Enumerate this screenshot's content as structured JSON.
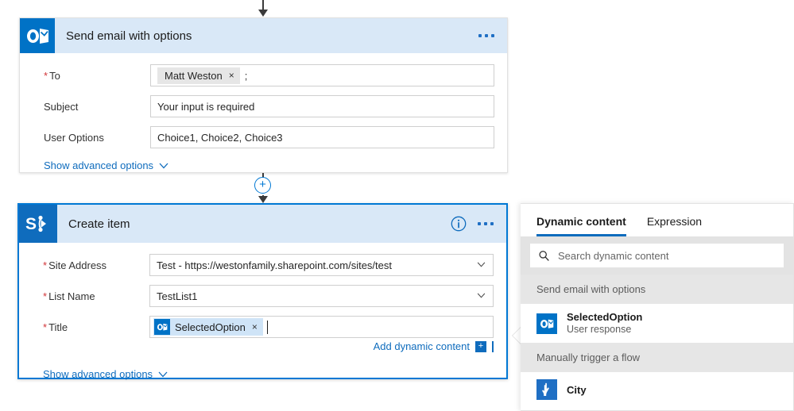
{
  "colors": {
    "accent": "#0078d4",
    "link": "#0f6cbd",
    "card_header_bg": "#d9e8f7",
    "required_star": "#d13438",
    "outlook_blue": "#0072c6",
    "sharepoint_blue": "#0f6cbd",
    "token_blue": "#cfe4f7",
    "token_gray": "#e6e6e6"
  },
  "flow": {
    "top_connector": {
      "name": "arrow-down"
    },
    "mid_connector": {
      "plus_label": "+"
    },
    "cards": [
      {
        "id": "send-email-with-options",
        "icon": "outlook-icon",
        "title": "Send email with options",
        "selected": false,
        "has_info": false,
        "ellipsis_label": "•••",
        "fields": [
          {
            "label": "To",
            "required": true,
            "type": "token",
            "token": {
              "text": "Matt Weston",
              "close": "×"
            },
            "trailing": ";"
          },
          {
            "label": "Subject",
            "required": false,
            "type": "text",
            "value": "Your input is required"
          },
          {
            "label": "User Options",
            "required": false,
            "type": "text",
            "value": "Choice1, Choice2, Choice3"
          }
        ],
        "show_advanced": "Show advanced options"
      },
      {
        "id": "create-item",
        "icon": "sharepoint-icon",
        "title": "Create item",
        "selected": true,
        "has_info": true,
        "ellipsis_label": "•••",
        "fields": [
          {
            "label": "Site Address",
            "required": true,
            "type": "dropdown",
            "value": "Test - https://westonfamily.sharepoint.com/sites/test"
          },
          {
            "label": "List Name",
            "required": true,
            "type": "dropdown",
            "value": "TestList1"
          },
          {
            "label": "Title",
            "required": true,
            "type": "dynamic-token",
            "token": {
              "icon": "outlook-icon",
              "text": "SelectedOption",
              "close": "×"
            }
          }
        ],
        "add_dynamic_content": "Add dynamic content",
        "add_dynamic_plus": "+",
        "show_advanced": "Show advanced options"
      }
    ]
  },
  "dynamic_panel": {
    "tabs": [
      {
        "label": "Dynamic content",
        "active": true
      },
      {
        "label": "Expression",
        "active": false
      }
    ],
    "search": {
      "icon": "search-icon",
      "placeholder": "Search dynamic content",
      "value": ""
    },
    "groups": [
      {
        "title": "Send email with options",
        "items": [
          {
            "icon": "outlook-icon",
            "name": "SelectedOption",
            "subtitle": "User response"
          }
        ]
      },
      {
        "title": "Manually trigger a flow",
        "items": [
          {
            "icon": "manual-trigger-icon",
            "name": "City",
            "subtitle": ""
          }
        ]
      }
    ]
  }
}
